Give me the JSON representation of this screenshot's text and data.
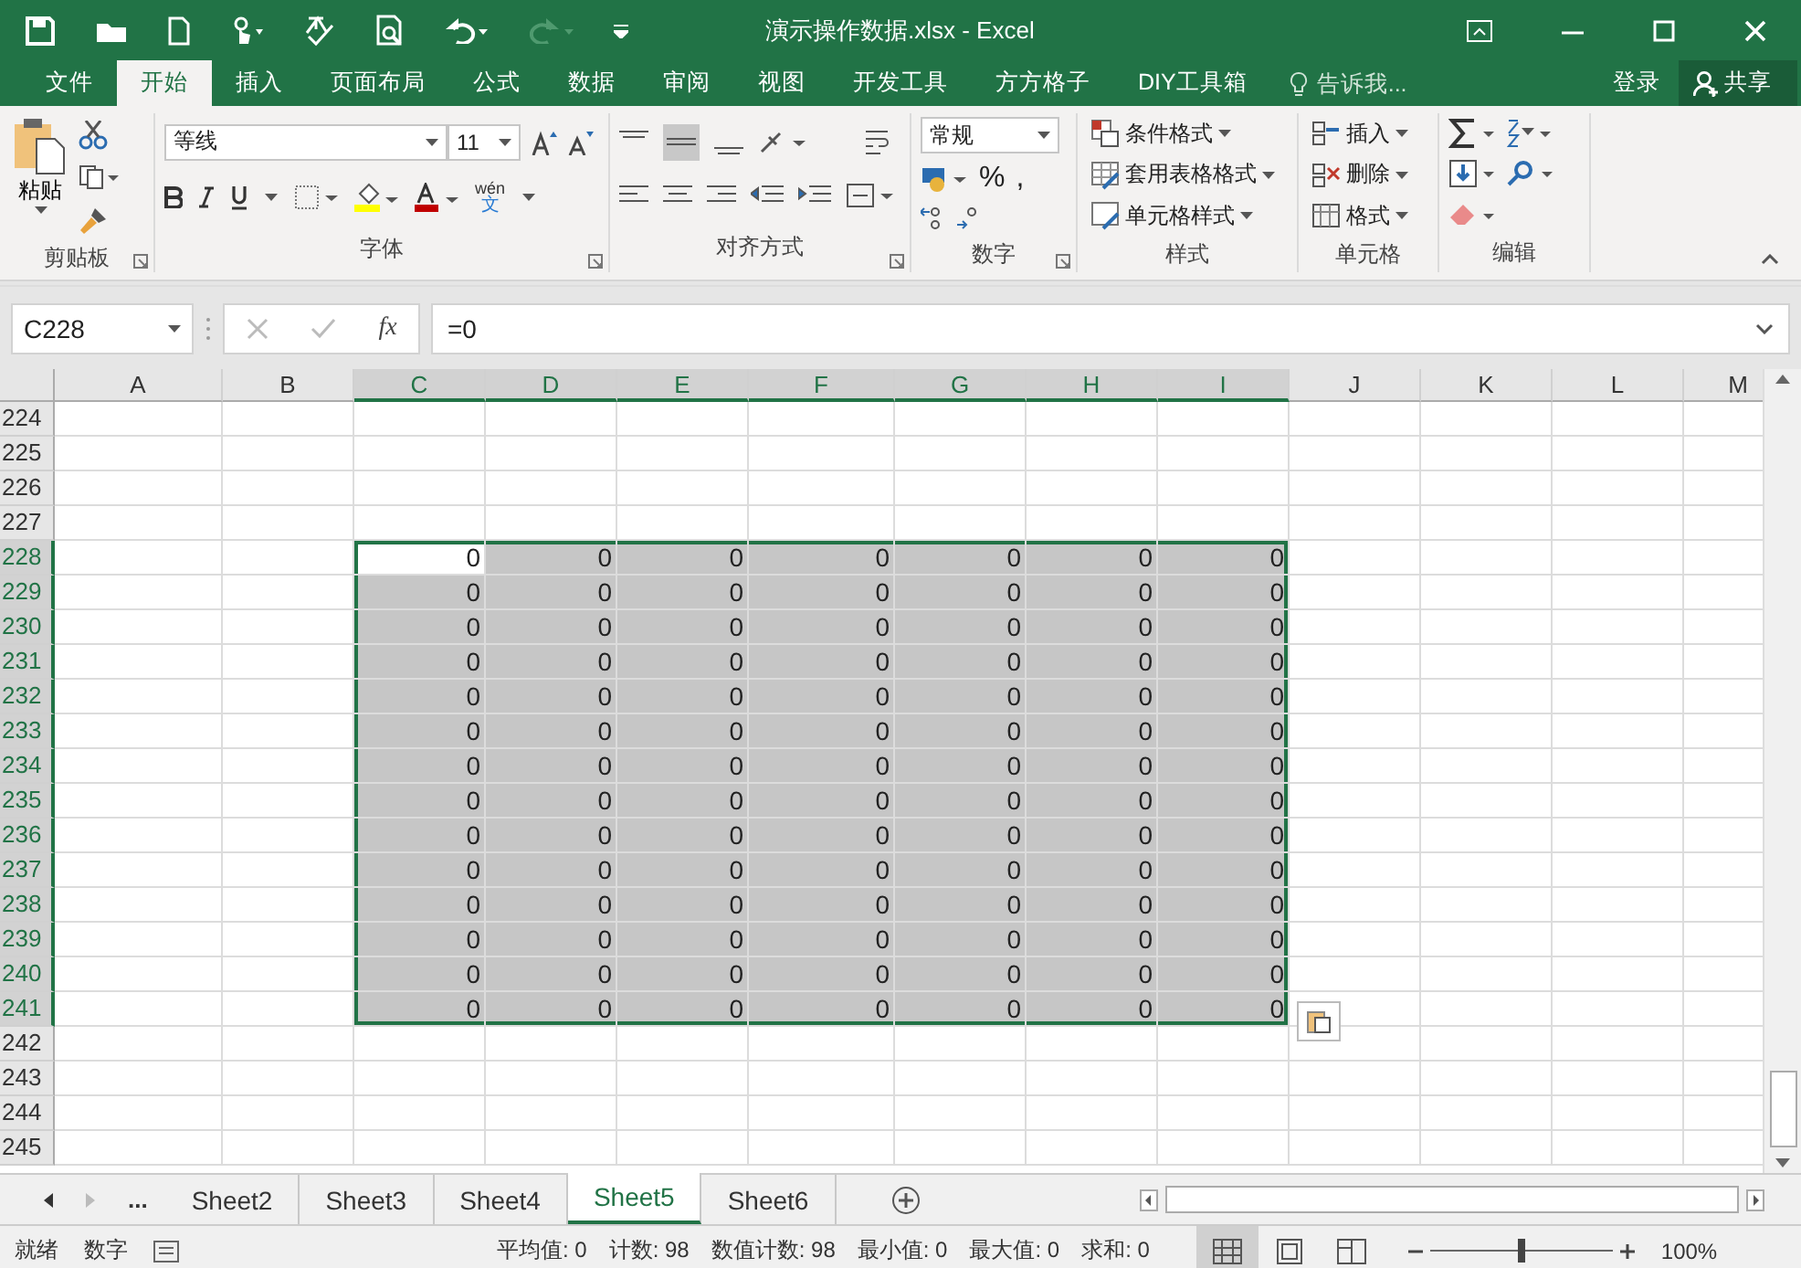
{
  "window": {
    "title": "演示操作数据.xlsx - Excel"
  },
  "ribbon_tabs": [
    {
      "label": "文件",
      "selected": false
    },
    {
      "label": "开始",
      "selected": true
    },
    {
      "label": "插入",
      "selected": false
    },
    {
      "label": "页面布局",
      "selected": false
    },
    {
      "label": "公式",
      "selected": false
    },
    {
      "label": "数据",
      "selected": false
    },
    {
      "label": "审阅",
      "selected": false
    },
    {
      "label": "视图",
      "selected": false
    },
    {
      "label": "开发工具",
      "selected": false
    },
    {
      "label": "方方格子",
      "selected": false
    },
    {
      "label": "DIY工具箱",
      "selected": false
    }
  ],
  "tell_me": {
    "placeholder": "告诉我..."
  },
  "sign_in": "登录",
  "share": "共享",
  "clipboard": {
    "paste": "粘贴",
    "label": "剪贴板"
  },
  "font": {
    "name": "等线",
    "size": "11",
    "phonetic": "wén",
    "phonetic_char": "文",
    "label": "字体"
  },
  "alignment": {
    "label": "对齐方式"
  },
  "number": {
    "format": "常规",
    "percent": "%",
    "comma": ",",
    "label": "数字"
  },
  "styles": {
    "items": [
      "条件格式",
      "套用表格格式",
      "单元格样式"
    ],
    "label": "样式"
  },
  "cells": {
    "items": [
      "插入",
      "删除",
      "格式"
    ],
    "label": "单元格"
  },
  "editing": {
    "label": "编辑"
  },
  "formula_bar": {
    "name_box": "C228",
    "fx": "fx",
    "formula": "=0"
  },
  "grid": {
    "columns": [
      {
        "label": "A",
        "selected": false
      },
      {
        "label": "B",
        "selected": false
      },
      {
        "label": "C",
        "selected": true
      },
      {
        "label": "D",
        "selected": true
      },
      {
        "label": "E",
        "selected": true
      },
      {
        "label": "F",
        "selected": true
      },
      {
        "label": "G",
        "selected": true
      },
      {
        "label": "H",
        "selected": true
      },
      {
        "label": "I",
        "selected": true
      },
      {
        "label": "J",
        "selected": false
      },
      {
        "label": "K",
        "selected": false
      },
      {
        "label": "L",
        "selected": false
      },
      {
        "label": "M",
        "selected": false
      }
    ],
    "rows": [
      {
        "label": "224",
        "selected": false
      },
      {
        "label": "225",
        "selected": false
      },
      {
        "label": "226",
        "selected": false
      },
      {
        "label": "227",
        "selected": false
      },
      {
        "label": "228",
        "selected": true,
        "cells": [
          {
            "value": "0",
            "active": true
          },
          {
            "value": "0",
            "active": false
          },
          {
            "value": "0",
            "active": false
          },
          {
            "value": "0",
            "active": false
          },
          {
            "value": "0",
            "active": false
          },
          {
            "value": "0",
            "active": false
          },
          {
            "value": "0",
            "active": false
          }
        ]
      },
      {
        "label": "229",
        "selected": true,
        "cells": [
          {
            "value": "0",
            "active": false
          },
          {
            "value": "0",
            "active": false
          },
          {
            "value": "0",
            "active": false
          },
          {
            "value": "0",
            "active": false
          },
          {
            "value": "0",
            "active": false
          },
          {
            "value": "0",
            "active": false
          },
          {
            "value": "0",
            "active": false
          }
        ]
      },
      {
        "label": "230",
        "selected": true,
        "cells": [
          {
            "value": "0",
            "active": false
          },
          {
            "value": "0",
            "active": false
          },
          {
            "value": "0",
            "active": false
          },
          {
            "value": "0",
            "active": false
          },
          {
            "value": "0",
            "active": false
          },
          {
            "value": "0",
            "active": false
          },
          {
            "value": "0",
            "active": false
          }
        ]
      },
      {
        "label": "231",
        "selected": true,
        "cells": [
          {
            "value": "0",
            "active": false
          },
          {
            "value": "0",
            "active": false
          },
          {
            "value": "0",
            "active": false
          },
          {
            "value": "0",
            "active": false
          },
          {
            "value": "0",
            "active": false
          },
          {
            "value": "0",
            "active": false
          },
          {
            "value": "0",
            "active": false
          }
        ]
      },
      {
        "label": "232",
        "selected": true,
        "cells": [
          {
            "value": "0",
            "active": false
          },
          {
            "value": "0",
            "active": false
          },
          {
            "value": "0",
            "active": false
          },
          {
            "value": "0",
            "active": false
          },
          {
            "value": "0",
            "active": false
          },
          {
            "value": "0",
            "active": false
          },
          {
            "value": "0",
            "active": false
          }
        ]
      },
      {
        "label": "233",
        "selected": true,
        "cells": [
          {
            "value": "0",
            "active": false
          },
          {
            "value": "0",
            "active": false
          },
          {
            "value": "0",
            "active": false
          },
          {
            "value": "0",
            "active": false
          },
          {
            "value": "0",
            "active": false
          },
          {
            "value": "0",
            "active": false
          },
          {
            "value": "0",
            "active": false
          }
        ]
      },
      {
        "label": "234",
        "selected": true,
        "cells": [
          {
            "value": "0",
            "active": false
          },
          {
            "value": "0",
            "active": false
          },
          {
            "value": "0",
            "active": false
          },
          {
            "value": "0",
            "active": false
          },
          {
            "value": "0",
            "active": false
          },
          {
            "value": "0",
            "active": false
          },
          {
            "value": "0",
            "active": false
          }
        ]
      },
      {
        "label": "235",
        "selected": true,
        "cells": [
          {
            "value": "0",
            "active": false
          },
          {
            "value": "0",
            "active": false
          },
          {
            "value": "0",
            "active": false
          },
          {
            "value": "0",
            "active": false
          },
          {
            "value": "0",
            "active": false
          },
          {
            "value": "0",
            "active": false
          },
          {
            "value": "0",
            "active": false
          }
        ]
      },
      {
        "label": "236",
        "selected": true,
        "cells": [
          {
            "value": "0",
            "active": false
          },
          {
            "value": "0",
            "active": false
          },
          {
            "value": "0",
            "active": false
          },
          {
            "value": "0",
            "active": false
          },
          {
            "value": "0",
            "active": false
          },
          {
            "value": "0",
            "active": false
          },
          {
            "value": "0",
            "active": false
          }
        ]
      },
      {
        "label": "237",
        "selected": true,
        "cells": [
          {
            "value": "0",
            "active": false
          },
          {
            "value": "0",
            "active": false
          },
          {
            "value": "0",
            "active": false
          },
          {
            "value": "0",
            "active": false
          },
          {
            "value": "0",
            "active": false
          },
          {
            "value": "0",
            "active": false
          },
          {
            "value": "0",
            "active": false
          }
        ]
      },
      {
        "label": "238",
        "selected": true,
        "cells": [
          {
            "value": "0",
            "active": false
          },
          {
            "value": "0",
            "active": false
          },
          {
            "value": "0",
            "active": false
          },
          {
            "value": "0",
            "active": false
          },
          {
            "value": "0",
            "active": false
          },
          {
            "value": "0",
            "active": false
          },
          {
            "value": "0",
            "active": false
          }
        ]
      },
      {
        "label": "239",
        "selected": true,
        "cells": [
          {
            "value": "0",
            "active": false
          },
          {
            "value": "0",
            "active": false
          },
          {
            "value": "0",
            "active": false
          },
          {
            "value": "0",
            "active": false
          },
          {
            "value": "0",
            "active": false
          },
          {
            "value": "0",
            "active": false
          },
          {
            "value": "0",
            "active": false
          }
        ]
      },
      {
        "label": "240",
        "selected": true,
        "cells": [
          {
            "value": "0",
            "active": false
          },
          {
            "value": "0",
            "active": false
          },
          {
            "value": "0",
            "active": false
          },
          {
            "value": "0",
            "active": false
          },
          {
            "value": "0",
            "active": false
          },
          {
            "value": "0",
            "active": false
          },
          {
            "value": "0",
            "active": false
          }
        ]
      },
      {
        "label": "241",
        "selected": true,
        "cells": [
          {
            "value": "0",
            "active": false
          },
          {
            "value": "0",
            "active": false
          },
          {
            "value": "0",
            "active": false
          },
          {
            "value": "0",
            "active": false
          },
          {
            "value": "0",
            "active": false
          },
          {
            "value": "0",
            "active": false
          },
          {
            "value": "0",
            "active": false
          }
        ]
      },
      {
        "label": "242",
        "selected": false
      },
      {
        "label": "243",
        "selected": false
      },
      {
        "label": "244",
        "selected": false
      },
      {
        "label": "245",
        "selected": false
      }
    ]
  },
  "sheet_tabs": {
    "more": "...",
    "tabs": [
      {
        "label": "Sheet2",
        "selected": false
      },
      {
        "label": "Sheet3",
        "selected": false
      },
      {
        "label": "Sheet4",
        "selected": false
      },
      {
        "label": "Sheet5",
        "selected": true
      },
      {
        "label": "Sheet6",
        "selected": false
      }
    ]
  },
  "status_bar": {
    "mode": "就绪",
    "num_lock": "数字",
    "stats": [
      "平均值: 0",
      "计数: 98",
      "数值计数: 98",
      "最小值: 0",
      "最大值: 0",
      "求和: 0"
    ],
    "view_buttons": [
      {
        "kind": "normal",
        "selected": true
      },
      {
        "kind": "page-layout",
        "selected": false
      },
      {
        "kind": "page-break",
        "selected": false
      }
    ],
    "zoom": {
      "level": 0.5,
      "reading": "100%"
    }
  }
}
